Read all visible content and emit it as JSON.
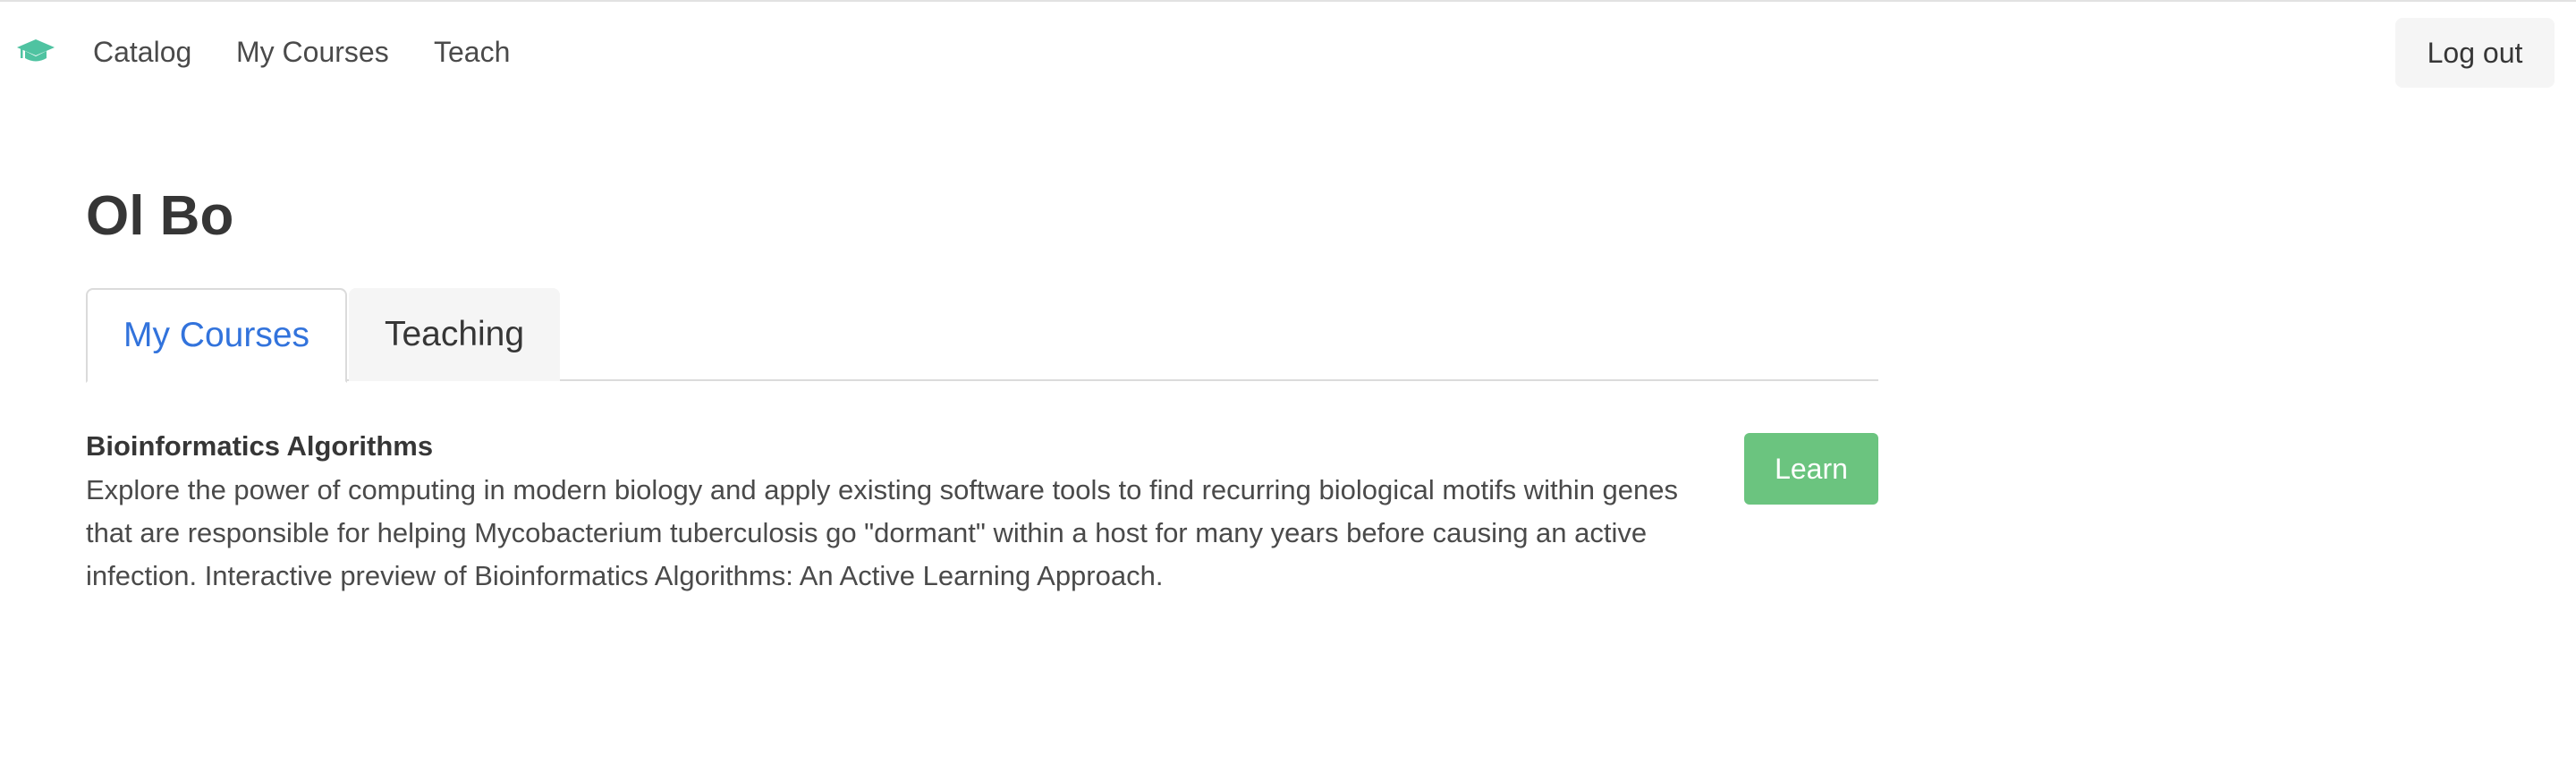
{
  "navbar": {
    "logo_icon": "graduation-cap-icon",
    "links": {
      "catalog": "Catalog",
      "my_courses": "My Courses",
      "teach": "Teach"
    },
    "logout_label": "Log out"
  },
  "page": {
    "title": "Ol Bo"
  },
  "tabs": {
    "my_courses": "My Courses",
    "teaching": "Teaching",
    "active": "My Courses"
  },
  "courses": [
    {
      "title": "Bioinformatics Algorithms",
      "description": "Explore the power of computing in modern biology and apply existing software tools to find recurring biological motifs within genes that are responsible for helping Mycobacterium tuberculosis go \"dormant\" within a host for many years before causing an active infection. Interactive preview of Bioinformatics Algorithms: An Active Learning Approach.",
      "action_label": "Learn"
    }
  ],
  "colors": {
    "logo": "#4fc3a1",
    "active_tab": "#3273dc",
    "learn_button": "#6bc47f",
    "tab_inactive_bg": "#f5f5f5"
  }
}
